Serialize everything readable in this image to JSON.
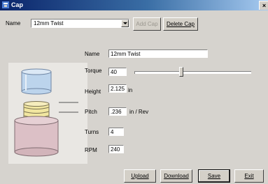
{
  "window": {
    "title": "Cap"
  },
  "toolbar": {
    "name_label": "Name",
    "name_selected": "12mm Twist",
    "add_cap_label": "Add Cap",
    "delete_cap_label": "Delete Cap"
  },
  "form": {
    "name_label": "Name",
    "name_value": "12mm Twist",
    "torque_label": "Torque",
    "torque_value": "40",
    "torque_slider_fraction": 0.4,
    "height_label": "Height",
    "height_value": "2.125",
    "height_unit": "in",
    "pitch_label": "Pitch",
    "pitch_value": ".236",
    "pitch_unit": "in / Rev",
    "turns_label": "Turns",
    "turns_value": "4",
    "rpm_label": "RPM",
    "rpm_value": "240"
  },
  "buttons": {
    "upload": "Upload",
    "download": "Download",
    "save": "Save",
    "exit": "Exit"
  },
  "colors": {
    "title_bar": "#0a246a",
    "dialog_face": "#d6d3ce",
    "cap_blue": "#bcd4ec",
    "thread_yellow": "#f1e6a0",
    "base_pink": "#dcc0c6"
  }
}
